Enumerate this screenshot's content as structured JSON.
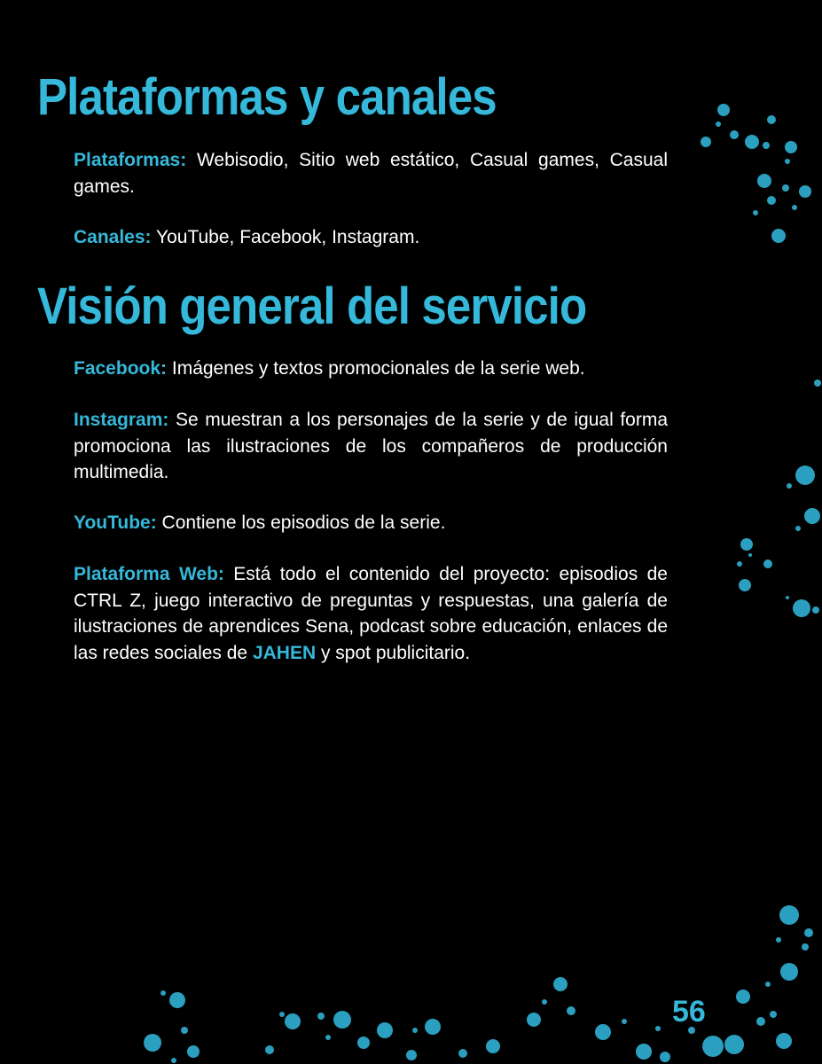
{
  "heading_platforms": "Plataformas y canales",
  "platforms": {
    "label": "Plataformas:",
    "text": " Webisodio, Sitio web estático, Casual games, Casual games."
  },
  "channels": {
    "label": "Canales:",
    "text": " YouTube, Facebook, Instagram."
  },
  "heading_service": "Visión general del servicio",
  "facebook": {
    "label": "Facebook:",
    "text": " Imágenes y textos promocionales de la serie web."
  },
  "instagram": {
    "label": "Instagram:",
    "text": " Se muestran a los personajes de la serie y de igual forma promociona las ilustraciones de los compañeros de producción multimedia."
  },
  "youtube": {
    "label": "YouTube:",
    "text": " Contiene los episodios de la serie."
  },
  "web": {
    "label": "Plataforma Web:",
    "text_before": " Está todo el contenido del proyecto: episodios de CTRL Z, juego interactivo de preguntas y respuestas, una galería de ilustraciones de aprendices Sena, podcast sobre educación, enlaces de las redes sociales de ",
    "highlight": "JAHEN",
    "text_after": " y spot publicitario."
  },
  "page_number": "56",
  "colors": {
    "accent": "#35b8d9",
    "background": "#000000",
    "text": "#ffffff"
  }
}
